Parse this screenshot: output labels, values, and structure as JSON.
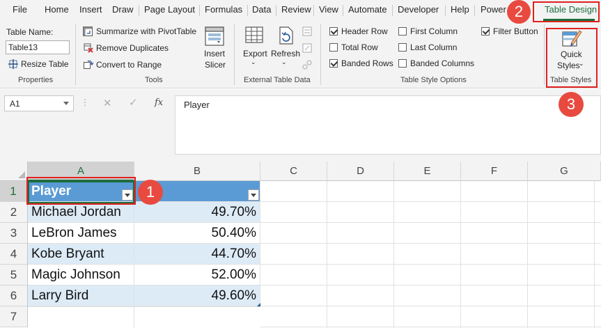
{
  "tabs": [
    {
      "label": "File"
    },
    {
      "label": "Home"
    },
    {
      "label": "Insert"
    },
    {
      "label": "Draw"
    },
    {
      "label": "Page Layout"
    },
    {
      "label": "Formulas"
    },
    {
      "label": "Data"
    },
    {
      "label": "Review"
    },
    {
      "label": "View"
    },
    {
      "label": "Automate"
    },
    {
      "label": "Developer"
    },
    {
      "label": "Help"
    },
    {
      "label": "Power P"
    },
    {
      "label": "Table Design"
    }
  ],
  "ribbon": {
    "properties": {
      "table_name_label": "Table Name:",
      "table_name_value": "Table13",
      "resize_label": "Resize Table",
      "group_title": "Properties"
    },
    "tools": {
      "summarize_label": "Summarize with PivotTable",
      "remove_dup_label": "Remove Duplicates",
      "convert_label": "Convert to Range",
      "slicer_label_1": "Insert",
      "slicer_label_2": "Slicer",
      "group_title": "Tools"
    },
    "external": {
      "export_label": "Export",
      "refresh_label": "Refresh",
      "group_title": "External Table Data"
    },
    "style_options": {
      "header_row": {
        "label": "Header Row",
        "checked": true
      },
      "total_row": {
        "label": "Total Row",
        "checked": false
      },
      "banded_rows": {
        "label": "Banded Rows",
        "checked": true
      },
      "first_column": {
        "label": "First Column",
        "checked": false
      },
      "last_column": {
        "label": "Last Column",
        "checked": false
      },
      "banded_columns": {
        "label": "Banded Columns",
        "checked": false
      },
      "filter_button": {
        "label": "Filter Button",
        "checked": true
      },
      "group_title": "Table Style Options"
    },
    "table_styles": {
      "quick_label_1": "Quick",
      "quick_label_2": "Styles",
      "group_title": "Table Styles"
    }
  },
  "formula_bar": {
    "name_box": "A1",
    "fx_label": "fx",
    "content": "Player"
  },
  "grid": {
    "columns": [
      "A",
      "B",
      "C",
      "D",
      "E",
      "F",
      "G"
    ],
    "rows": [
      "1",
      "2",
      "3",
      "4",
      "5",
      "6",
      "7"
    ],
    "cells": [
      [
        "Player",
        ""
      ],
      [
        "Michael Jordan",
        "49.70%"
      ],
      [
        "LeBron James",
        "50.40%"
      ],
      [
        "Kobe Bryant",
        "44.70%"
      ],
      [
        "Magic Johnson",
        "52.00%"
      ],
      [
        "Larry Bird",
        "49.60%"
      ]
    ]
  },
  "callouts": [
    "1",
    "2",
    "3"
  ],
  "colors": {
    "accent_green": "#1e6e3c",
    "table_header": "#5b9bd5",
    "table_band": "#ddebf7",
    "callout_red": "#e84a3f"
  }
}
